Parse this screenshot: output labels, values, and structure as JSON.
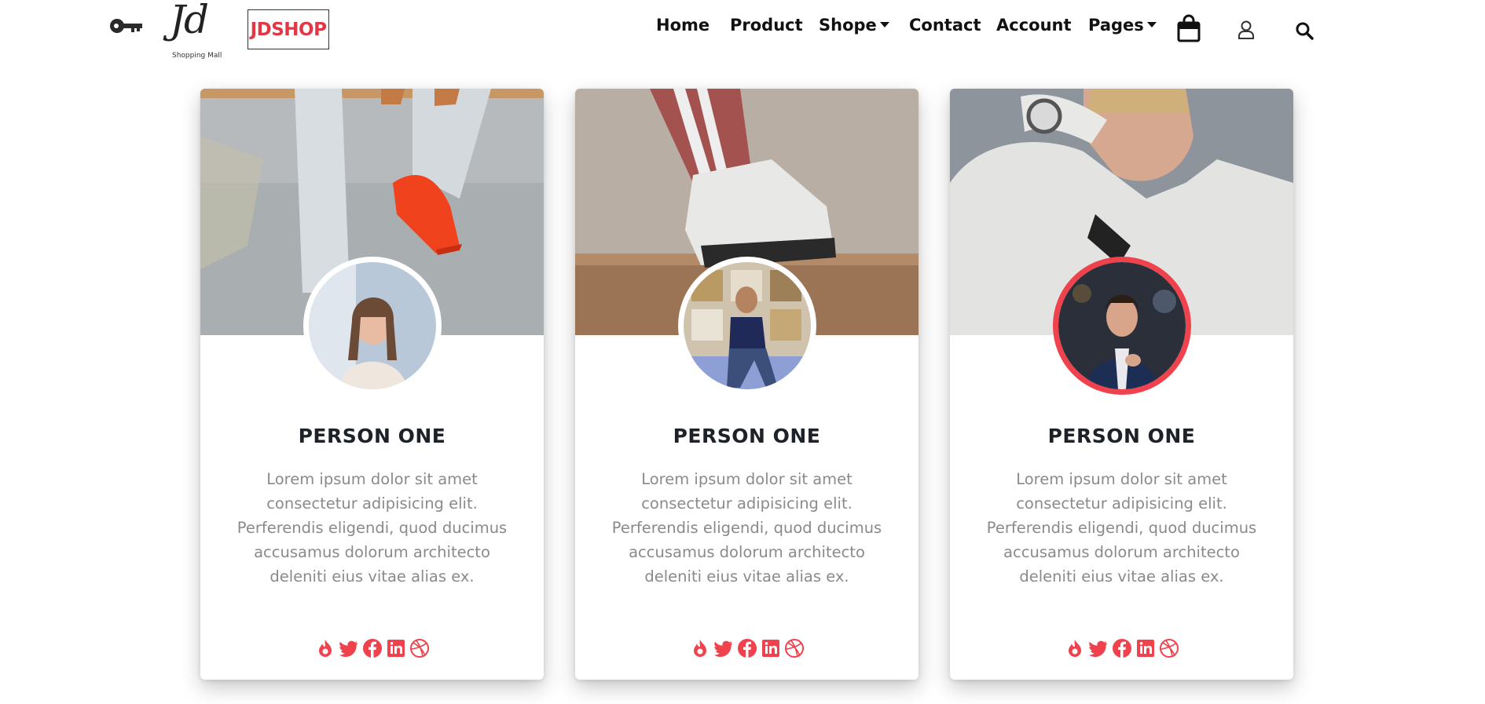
{
  "brand": {
    "logo_script": "Jd",
    "logo_subtitle": "Shopping Mall",
    "name": "JDSHOP",
    "accent": "#f0424c"
  },
  "nav": {
    "items": [
      {
        "label": "Home"
      },
      {
        "label": "Product"
      },
      {
        "label": "Shope"
      },
      {
        "label": "Contact"
      },
      {
        "label": "Account"
      },
      {
        "label": "Pages"
      }
    ],
    "icons": [
      "shopping-bag-icon",
      "user-icon",
      "search-icon"
    ]
  },
  "cards": [
    {
      "name": "PERSON ONE",
      "description": "Lorem ipsum dolor sit amet consectetur adipisicing elit. Perferendis eligendi, quod ducimus accusamus dolorum architecto deleniti eius vitae alias ex.",
      "active": false
    },
    {
      "name": "PERSON ONE",
      "description": "Lorem ipsum dolor sit amet consectetur adipisicing elit. Perferendis eligendi, quod ducimus accusamus dolorum architecto deleniti eius vitae alias ex.",
      "active": false
    },
    {
      "name": "PERSON ONE",
      "description": "Lorem ipsum dolor sit amet consectetur adipisicing elit. Perferendis eligendi, quod ducimus accusamus dolorum architecto deleniti eius vitae alias ex.",
      "active": true
    }
  ],
  "social_icons": [
    "fire-icon",
    "twitter-icon",
    "facebook-icon",
    "linkedin-icon",
    "dribbble-icon"
  ]
}
